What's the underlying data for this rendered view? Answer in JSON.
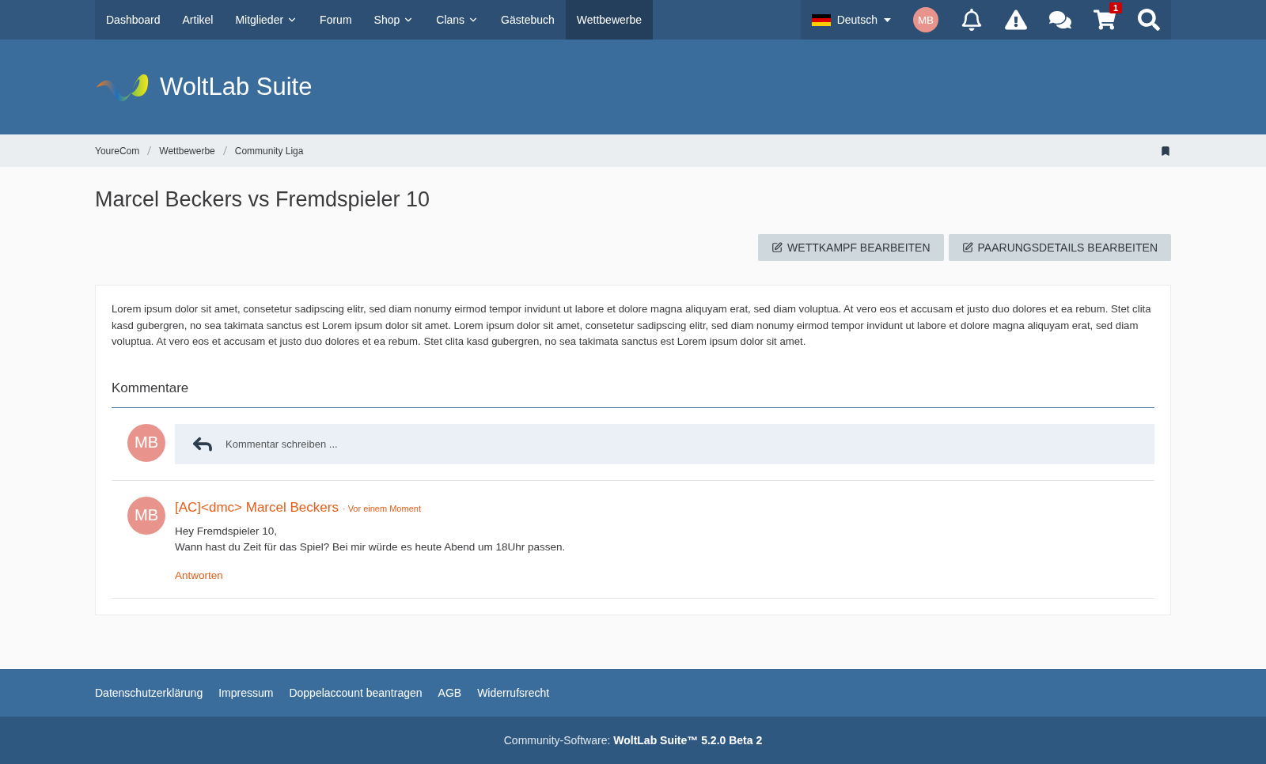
{
  "nav": {
    "items": [
      {
        "label": "Dashboard",
        "dropdown": false,
        "selected": false
      },
      {
        "label": "Artikel",
        "dropdown": false,
        "selected": false
      },
      {
        "label": "Mitglieder",
        "dropdown": true,
        "selected": false
      },
      {
        "label": "Forum",
        "dropdown": false,
        "selected": false
      },
      {
        "label": "Shop",
        "dropdown": true,
        "selected": false
      },
      {
        "label": "Clans",
        "dropdown": true,
        "selected": false
      },
      {
        "label": "Gästebuch",
        "dropdown": false,
        "selected": false
      },
      {
        "label": "Wettbewerbe",
        "dropdown": false,
        "selected": true
      }
    ],
    "language": "Deutsch",
    "avatar": "MB",
    "icons": [
      {
        "kind": "bell"
      },
      {
        "kind": "warning"
      },
      {
        "kind": "chat"
      },
      {
        "kind": "cart",
        "badge": "1"
      },
      {
        "kind": "search"
      }
    ]
  },
  "logo": "WoltLab Suite",
  "breadcrumbs": [
    "YoureCom",
    "Wettbewerbe",
    "Community Liga"
  ],
  "page_title": "Marcel Beckers vs Fremdspieler 10",
  "buttons": [
    "WETTKAMPF BEARBEITEN",
    "PAARUNGSDETAILS BEARBEITEN"
  ],
  "description": "Lorem ipsum dolor sit amet, consetetur sadipscing elitr, sed diam nonumy eirmod tempor invidunt ut labore et dolore magna aliquyam erat, sed diam voluptua. At vero eos et accusam et justo duo dolores et ea rebum. Stet clita kasd gubergren, no sea takimata sanctus est Lorem ipsum dolor sit amet. Lorem ipsum dolor sit amet, consetetur sadipscing elitr, sed diam nonumy eirmod tempor invidunt ut labore et dolore magna aliquyam erat, sed diam voluptua. At vero eos et accusam et justo duo dolores et ea rebum. Stet clita kasd gubergren, no sea takimata sanctus est Lorem ipsum dolor sit amet.",
  "comments": {
    "title": "Kommentare",
    "new_comment": {
      "avatar": "MB",
      "placeholder": "Kommentar schreiben ..."
    },
    "items": [
      {
        "avatar": "MB",
        "author": "[AC]<dmc> Marcel Beckers",
        "time": "· Vor einem Moment",
        "lines": [
          "Hey Fremdspieler 10,",
          "Wann hast du Zeit für das Spiel? Bei mir würde es heute Abend um 18Uhr passen."
        ],
        "reply": "Antworten"
      }
    ]
  },
  "footer": {
    "links": [
      "Datenschutzerklärung",
      "Impressum",
      "Doppelaccount beantragen",
      "AGB",
      "Widerrufsrecht"
    ],
    "copyright": "Community-Software: **WoltLab Suite™ 5.2.0 Beta 2**"
  }
}
